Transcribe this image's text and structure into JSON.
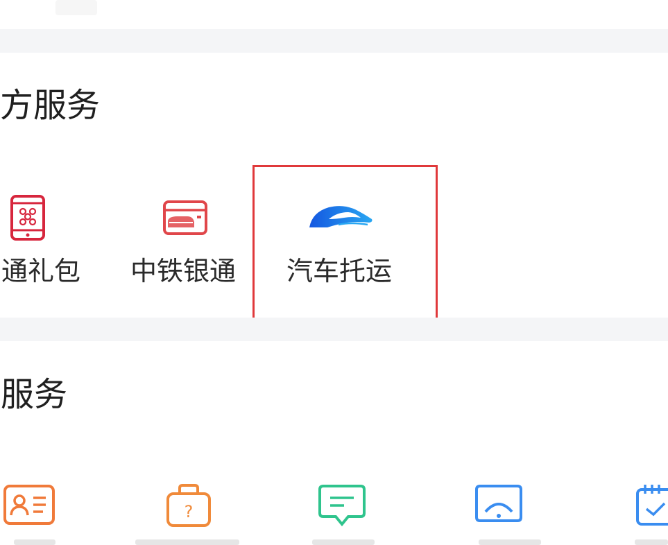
{
  "sections": {
    "third_party": {
      "title": "三方服务",
      "items": [
        {
          "label": "通礼包",
          "icon": "unicom-phone-icon",
          "color": "#d7263d"
        },
        {
          "label": "中铁银通",
          "icon": "railway-card-icon",
          "color": "#e0464a"
        },
        {
          "label": "汽车托运",
          "icon": "car-icon",
          "color": "#1e74e8"
        }
      ]
    },
    "warm": {
      "title": "馨服务",
      "items": [
        {
          "icon": "id-card-icon",
          "color": "#f07a3a"
        },
        {
          "icon": "lost-found-icon",
          "color": "#f08a3a"
        },
        {
          "icon": "message-icon",
          "color": "#2fc48d"
        },
        {
          "icon": "wifi-screen-icon",
          "color": "#3a8df0"
        },
        {
          "icon": "calendar-check-icon",
          "color": "#3a8df0"
        }
      ]
    }
  }
}
